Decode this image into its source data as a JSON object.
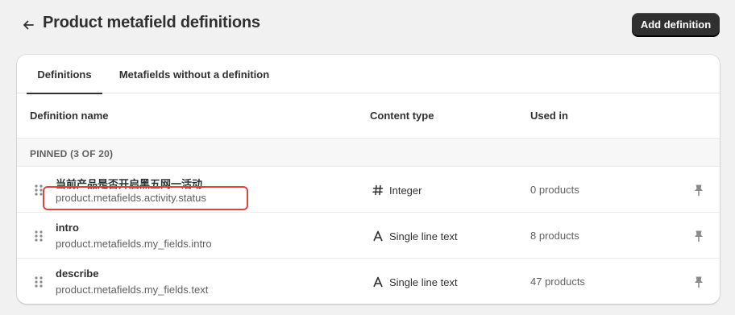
{
  "header": {
    "title": "Product metafield definitions",
    "add_button": "Add definition"
  },
  "tabs": [
    {
      "label": "Definitions",
      "active": true
    },
    {
      "label": "Metafields without a definition",
      "active": false
    }
  ],
  "table": {
    "columns": [
      "Definition name",
      "Content type",
      "Used in"
    ],
    "pinned_label": "PINNED (3 OF 20)",
    "rows": [
      {
        "name": "当前产品是否开启黑五网一活动",
        "key": "product.metafields.activity.status",
        "content_type": "Integer",
        "type_icon": "hash-icon",
        "used_in": "0 products"
      },
      {
        "name": "intro",
        "key": "product.metafields.my_fields.intro",
        "content_type": "Single line text",
        "type_icon": "text-icon",
        "used_in": "8 products"
      },
      {
        "name": "describe",
        "key": "product.metafields.my_fields.text",
        "content_type": "Single line text",
        "type_icon": "text-icon",
        "used_in": "47 products"
      }
    ]
  },
  "colors": {
    "background": "#f1f1f1",
    "primary_button": "#303030",
    "highlight_box": "#e0443e"
  }
}
